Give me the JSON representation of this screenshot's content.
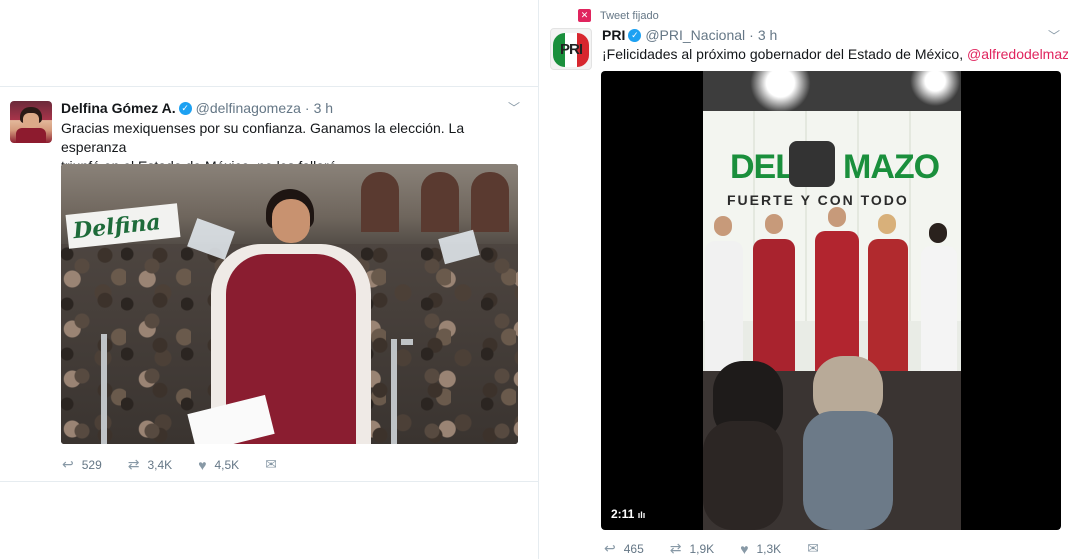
{
  "left_tweet": {
    "display_name": "Delfina Gómez A.",
    "handle": "@delfinagomeza",
    "separator": "·",
    "time": "3 h",
    "text_line1": "Gracias mexiquenses por su confianza. Ganamos la elección. La esperanza",
    "text_line2": "triunfó en el Estado de México, no les fallaré.",
    "photo_banner_text": "Delfina",
    "actions": {
      "replies": "529",
      "retweets": "3,4K",
      "likes": "4,5K"
    }
  },
  "right_tweet": {
    "pinned_label": "Tweet fijado",
    "display_name": "PRI",
    "handle": "@PRI_Nacional",
    "separator": "·",
    "time": "3 h",
    "text_before": "¡Felicidades al próximo gobernador del Estado de México, ",
    "mention": "@alfredodelmazo",
    "text_after": "!",
    "avatar_text": "PRI",
    "video": {
      "duration": "2:11",
      "backdrop_del": "DEL",
      "backdrop_mazo": "MAZO",
      "backdrop_slogan": "FUERTE Y CON TODO"
    },
    "actions": {
      "replies": "465",
      "retweets": "1,9K",
      "likes": "1,3K"
    }
  },
  "colors": {
    "mention": "#e0245e",
    "verified": "#1da1f2",
    "muted": "#657786",
    "pinned_badge": "#e0245e"
  },
  "icons": [
    "verified-icon",
    "chevron-down-icon",
    "reply-icon",
    "retweet-icon",
    "heart-icon",
    "dm-icon",
    "pin-icon",
    "volume-bars-icon"
  ]
}
